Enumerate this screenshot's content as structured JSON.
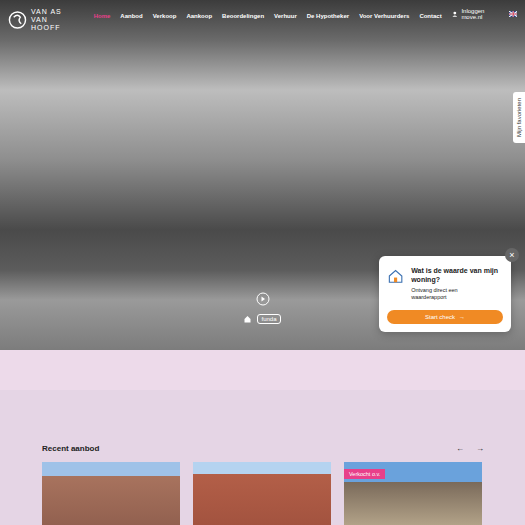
{
  "logo": {
    "line1": "VAN AS",
    "line2": "VAN HOOFF"
  },
  "nav": [
    {
      "label": "Home",
      "selected": true
    },
    {
      "label": "Aanbod",
      "selected": false
    },
    {
      "label": "Verkoop",
      "selected": false
    },
    {
      "label": "Aankoop",
      "selected": false
    },
    {
      "label": "Beoordelingen",
      "selected": false
    },
    {
      "label": "Verhuur",
      "selected": false
    },
    {
      "label": "De Hypotheker",
      "selected": false
    },
    {
      "label": "Voor Verhuurders",
      "selected": false
    },
    {
      "label": "Contact",
      "selected": false
    }
  ],
  "account": {
    "login": "Inloggen move.nl"
  },
  "hero": {
    "badge": "funda"
  },
  "favorites_tab": {
    "label": "Mijn favorieten"
  },
  "valuation_popup": {
    "title": "Wat is de waarde van mijn woning?",
    "subtitle": "Ontvang direct een waarderapport",
    "button": "Start check",
    "button_icon": "→",
    "close": "×"
  },
  "recent": {
    "title": "Recent aanbod",
    "prev": "←",
    "next": "→",
    "cards": [
      {
        "badge": ""
      },
      {
        "badge": ""
      },
      {
        "badge": "Verkocht o.v."
      }
    ]
  }
}
